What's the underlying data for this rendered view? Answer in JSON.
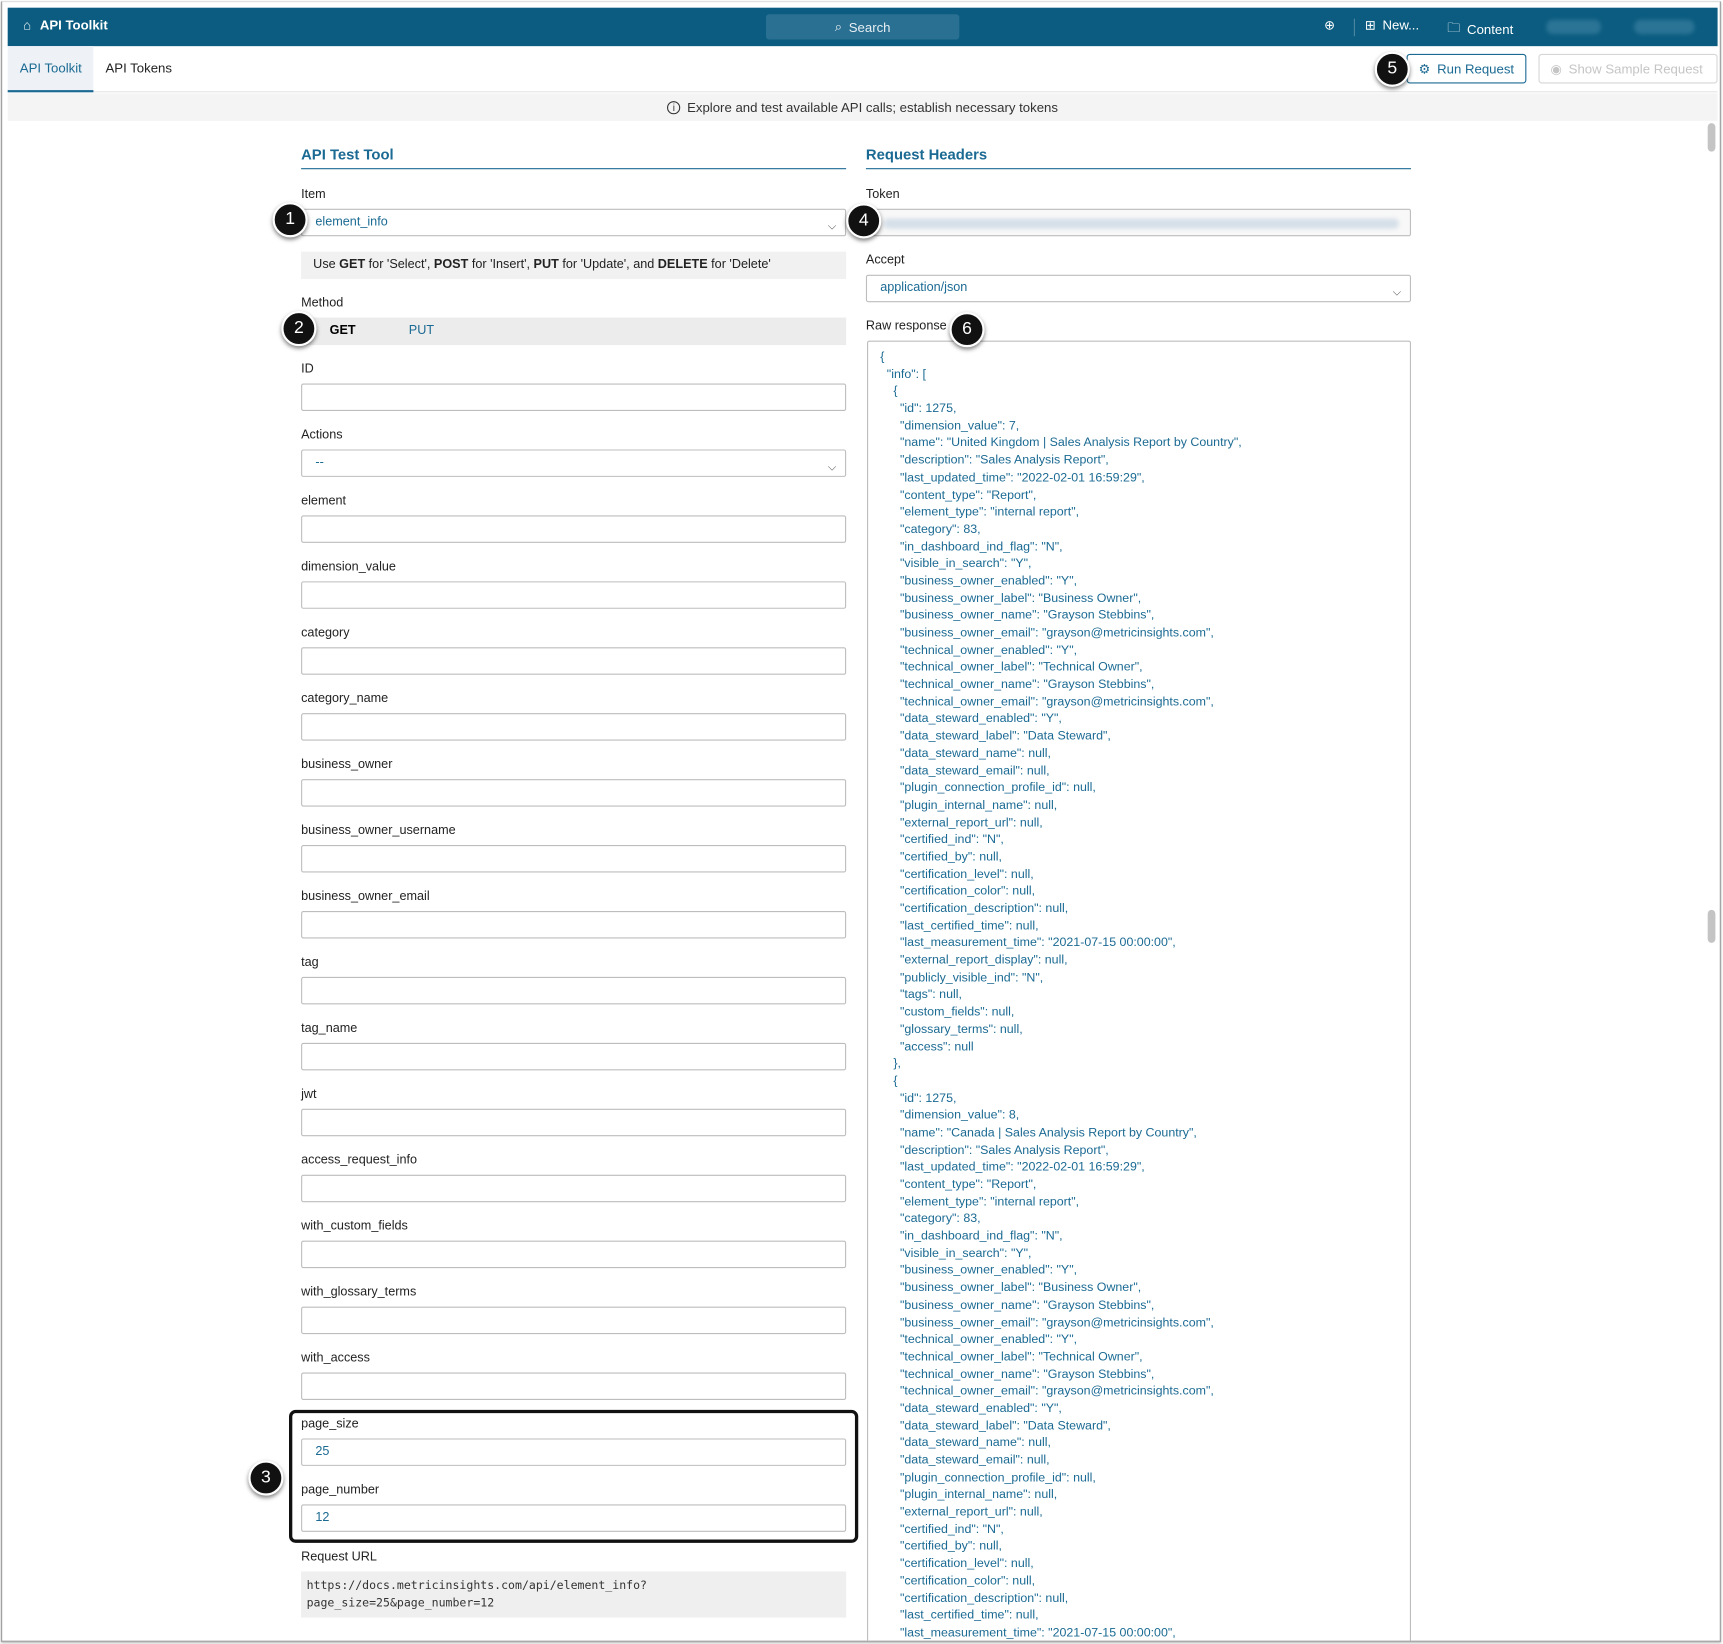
{
  "topbar": {
    "title": "API Toolkit",
    "search": "Search",
    "new_label": "New...",
    "content_label": "Content"
  },
  "tabs": [
    {
      "label": "API Toolkit",
      "active": true
    },
    {
      "label": "API Tokens",
      "active": false
    }
  ],
  "actions": {
    "run": "Run Request",
    "sample": "Show Sample Request"
  },
  "info": "Explore and test available API calls; establish necessary tokens",
  "left": {
    "title": "API Test Tool",
    "item_label": "Item",
    "item_value": "element_info",
    "hint": {
      "p1": "Use ",
      "get": "GET",
      "p2": " for 'Select', ",
      "post": "POST",
      "p3": " for 'Insert', ",
      "put": "PUT",
      "p4": " for 'Update', and ",
      "del": "DELETE",
      "p5": " for 'Delete'"
    },
    "method_label": "Method",
    "methods": [
      "GET",
      "PUT"
    ],
    "fields": [
      {
        "label": "ID",
        "value": ""
      },
      {
        "label": "Actions",
        "value": "--",
        "select": true
      },
      {
        "label": "element",
        "value": ""
      },
      {
        "label": "dimension_value",
        "value": ""
      },
      {
        "label": "category",
        "value": ""
      },
      {
        "label": "category_name",
        "value": ""
      },
      {
        "label": "business_owner",
        "value": ""
      },
      {
        "label": "business_owner_username",
        "value": ""
      },
      {
        "label": "business_owner_email",
        "value": ""
      },
      {
        "label": "tag",
        "value": ""
      },
      {
        "label": "tag_name",
        "value": ""
      },
      {
        "label": "jwt",
        "value": ""
      },
      {
        "label": "access_request_info",
        "value": ""
      },
      {
        "label": "with_custom_fields",
        "value": ""
      },
      {
        "label": "with_glossary_terms",
        "value": ""
      },
      {
        "label": "with_access",
        "value": ""
      },
      {
        "label": "page_size",
        "value": "25"
      },
      {
        "label": "page_number",
        "value": "12"
      }
    ],
    "url_label": "Request URL",
    "url_line1": "https://docs.metricinsights.com/api/element_info?",
    "url_line2": "page_size=25&page_number=12"
  },
  "right": {
    "title": "Request Headers",
    "token_label": "Token",
    "accept_label": "Accept",
    "accept_value": "application/json",
    "raw_label": "Raw response",
    "lines": [
      "{",
      " \"info\": [",
      "  {",
      "   \"id\": 1275,",
      "   \"dimension_value\": 7,",
      "   \"name\": \"United Kingdom | Sales Analysis Report by Country\",",
      "   \"description\": \"Sales Analysis Report\",",
      "   \"last_updated_time\": \"2022-02-01 16:59:29\",",
      "   \"content_type\": \"Report\",",
      "   \"element_type\": \"internal report\",",
      "   \"category\": 83,",
      "   \"in_dashboard_ind_flag\": \"N\",",
      "   \"visible_in_search\": \"Y\",",
      "   \"business_owner_enabled\": \"Y\",",
      "   \"business_owner_label\": \"Business Owner\",",
      "   \"business_owner_name\": \"Grayson Stebbins\",",
      "   \"business_owner_email\": \"grayson@metricinsights.com\",",
      "   \"technical_owner_enabled\": \"Y\",",
      "   \"technical_owner_label\": \"Technical Owner\",",
      "   \"technical_owner_name\": \"Grayson Stebbins\",",
      "   \"technical_owner_email\": \"grayson@metricinsights.com\",",
      "   \"data_steward_enabled\": \"Y\",",
      "   \"data_steward_label\": \"Data Steward\",",
      "   \"data_steward_name\": null,",
      "   \"data_steward_email\": null,",
      "   \"plugin_connection_profile_id\": null,",
      "   \"plugin_internal_name\": null,",
      "   \"external_report_url\": null,",
      "   \"certified_ind\": \"N\",",
      "   \"certified_by\": null,",
      "   \"certification_level\": null,",
      "   \"certification_color\": null,",
      "   \"certification_description\": null,",
      "   \"last_certified_time\": null,",
      "   \"last_measurement_time\": \"2021-07-15 00:00:00\",",
      "   \"external_report_display\": null,",
      "   \"publicly_visible_ind\": \"N\",",
      "   \"tags\": null,",
      "   \"custom_fields\": null,",
      "   \"glossary_terms\": null,",
      "   \"access\": null",
      "  },",
      "  {",
      "   \"id\": 1275,",
      "   \"dimension_value\": 8,",
      "   \"name\": \"Canada | Sales Analysis Report by Country\",",
      "   \"description\": \"Sales Analysis Report\",",
      "   \"last_updated_time\": \"2022-02-01 16:59:29\",",
      "   \"content_type\": \"Report\",",
      "   \"element_type\": \"internal report\",",
      "   \"category\": 83,",
      "   \"in_dashboard_ind_flag\": \"N\",",
      "   \"visible_in_search\": \"Y\",",
      "   \"business_owner_enabled\": \"Y\",",
      "   \"business_owner_label\": \"Business Owner\",",
      "   \"business_owner_name\": \"Grayson Stebbins\",",
      "   \"business_owner_email\": \"grayson@metricinsights.com\",",
      "   \"technical_owner_enabled\": \"Y\",",
      "   \"technical_owner_label\": \"Technical Owner\",",
      "   \"technical_owner_name\": \"Grayson Stebbins\",",
      "   \"technical_owner_email\": \"grayson@metricinsights.com\",",
      "   \"data_steward_enabled\": \"Y\",",
      "   \"data_steward_label\": \"Data Steward\",",
      "   \"data_steward_name\": null,",
      "   \"data_steward_email\": null,",
      "   \"plugin_connection_profile_id\": null,",
      "   \"plugin_internal_name\": null,",
      "   \"external_report_url\": null,",
      "   \"certified_ind\": \"N\",",
      "   \"certified_by\": null,",
      "   \"certification_level\": null,",
      "   \"certification_color\": null,",
      "   \"certification_description\": null,",
      "   \"last_certified_time\": null,",
      "   \"last_measurement_time\": \"2021-07-15 00:00:00\","
    ]
  },
  "callouts": [
    "1",
    "2",
    "3",
    "4",
    "5",
    "6"
  ],
  "colors": {
    "topbar": "#0b5c80",
    "accent": "#1b6a93"
  }
}
